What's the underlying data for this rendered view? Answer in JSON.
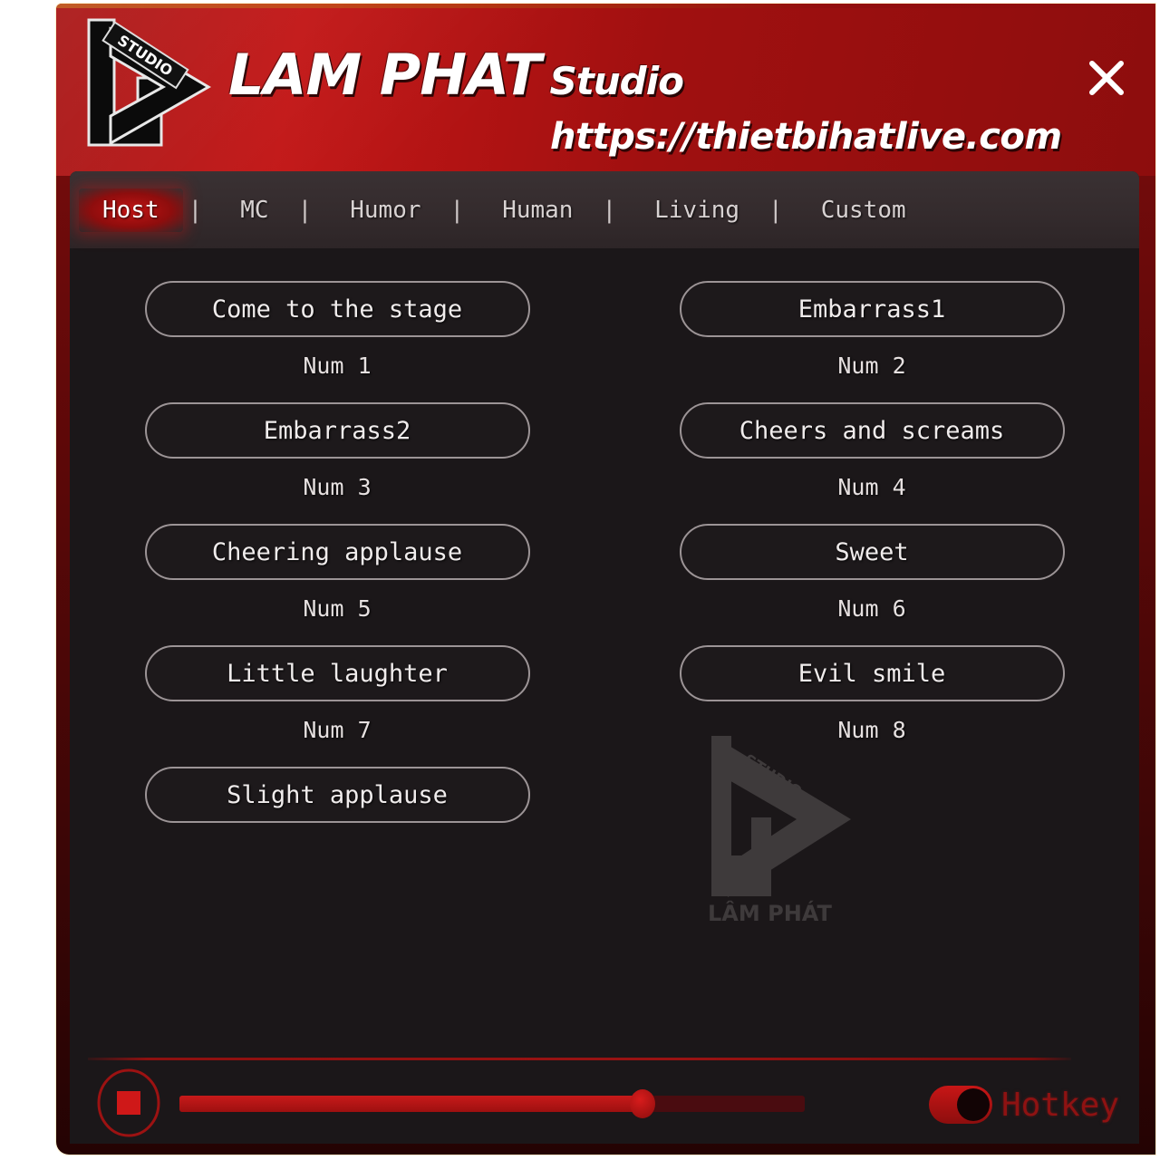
{
  "window": {
    "brand_name_main": "LAM PHAT",
    "brand_name_sub": "Studio",
    "brand_url": "https://thietbihatlive.com",
    "logo_mark_text": "STUDIO",
    "close_label": "✕"
  },
  "tabs": {
    "separator": "|",
    "items": [
      {
        "label": "Host",
        "active": true
      },
      {
        "label": "MC",
        "active": false
      },
      {
        "label": "Humor",
        "active": false
      },
      {
        "label": "Human",
        "active": false
      },
      {
        "label": "Living",
        "active": false
      },
      {
        "label": "Custom",
        "active": false
      }
    ]
  },
  "sounds": [
    {
      "label": "Come to the stage",
      "hotkey": "Num 1"
    },
    {
      "label": "Embarrass1",
      "hotkey": "Num 2"
    },
    {
      "label": "Embarrass2",
      "hotkey": "Num 3"
    },
    {
      "label": "Cheers and screams",
      "hotkey": "Num 4"
    },
    {
      "label": "Cheering applause",
      "hotkey": "Num 5"
    },
    {
      "label": "Sweet",
      "hotkey": "Num 6"
    },
    {
      "label": "Little laughter",
      "hotkey": "Num 7"
    },
    {
      "label": "Evil smile",
      "hotkey": "Num 8"
    },
    {
      "label": "Slight applause",
      "hotkey": ""
    }
  ],
  "watermark": {
    "brand_text": "LÂM PHÁT",
    "mark_text": "STUDIO"
  },
  "bottom_bar": {
    "stop_label": "stop",
    "volume_percent": 74,
    "hotkey_label": "Hotkey",
    "hotkey_enabled": true
  },
  "colors": {
    "brand_red": "#c21616",
    "frame_dark_red": "#5c0808",
    "panel_bg": "#1b1719",
    "tabbar_bg": "#342b2d",
    "button_border": "#9c9496",
    "accent_red": "#c81a1a",
    "hotkey_text": "#8e1212"
  }
}
